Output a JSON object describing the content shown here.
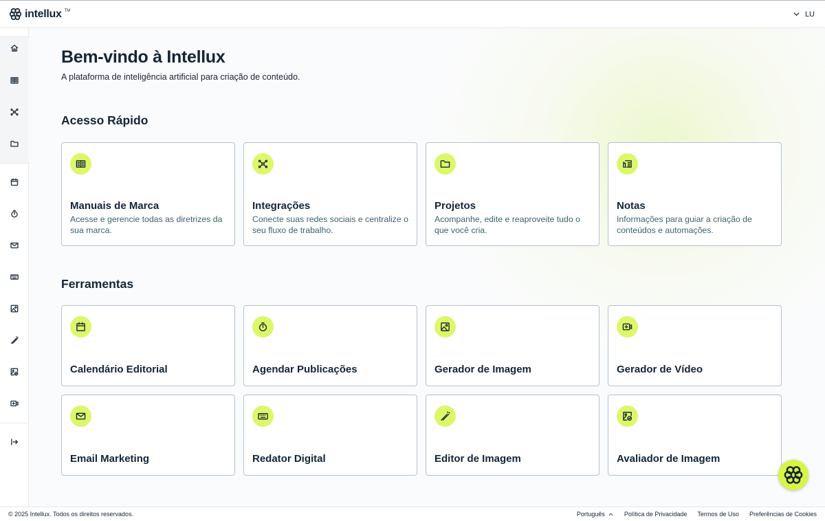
{
  "app": {
    "brand": "intellux",
    "trademark": "TM",
    "user_initials": "LU"
  },
  "welcome": {
    "title": "Bem-vindo à Intellux",
    "subtitle": "A plataforma de inteligência artificial para criação de conteúdo."
  },
  "quick_access": {
    "title": "Acesso Rápido",
    "cards": [
      {
        "icon": "book-icon",
        "title": "Manuais de Marca",
        "desc": "Acesse e gerencie todas as diretrizes da sua marca."
      },
      {
        "icon": "network-icon",
        "title": "Integrações",
        "desc": "Conecte suas redes sociais e centralize o seu fluxo de trabalho."
      },
      {
        "icon": "folder-icon",
        "title": "Projetos",
        "desc": "Acompanhe, edite e reaproveite tudo o que você cria."
      },
      {
        "icon": "notes-icon",
        "title": "Notas",
        "desc": "Informações para guiar a criação de conteúdos e automações."
      }
    ]
  },
  "tools": {
    "title": "Ferramentas",
    "cards": [
      {
        "icon": "calendar-icon",
        "title": "Calendário Editorial"
      },
      {
        "icon": "timer-icon",
        "title": "Agendar Publicações"
      },
      {
        "icon": "image-icon",
        "title": "Gerador de Imagem"
      },
      {
        "icon": "video-icon",
        "title": "Gerador de Vídeo"
      },
      {
        "icon": "mail-icon",
        "title": "Email Marketing"
      },
      {
        "icon": "keyboard-icon",
        "title": "Redator Digital"
      },
      {
        "icon": "wand-icon",
        "title": "Editor de Imagem"
      },
      {
        "icon": "image-check-icon",
        "title": "Avaliador de Imagem"
      }
    ]
  },
  "sidebar": {
    "icons": [
      "home-icon",
      "book-icon",
      "network-icon",
      "folder-icon",
      "calendar-icon",
      "timer-icon",
      "mail-icon",
      "keyboard-icon",
      "image-icon",
      "wand-icon",
      "image-check-icon",
      "video-icon",
      "logout-icon"
    ]
  },
  "footer": {
    "copyright": "© 2025 Intellux. Todos os direitos reservados.",
    "language": "Português",
    "privacy": "Política de Privacidade",
    "terms": "Termos de Uso",
    "cookies": "Preferências de Cookies"
  },
  "colors": {
    "accent": "#dcf76a",
    "text": "#142536",
    "description": "#3c6173",
    "card_border": "#b5c2cc"
  }
}
